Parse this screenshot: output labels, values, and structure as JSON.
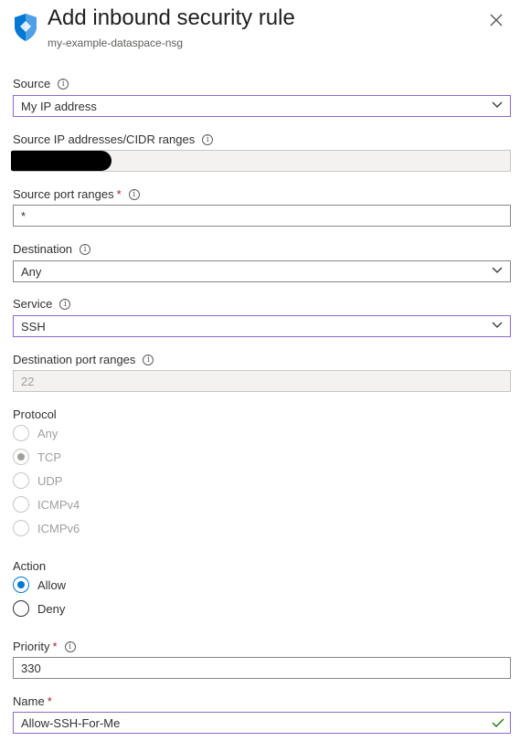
{
  "header": {
    "title": "Add inbound security rule",
    "subtitle": "my-example-dataspace-nsg"
  },
  "colors": {
    "shield": "#0078d4",
    "focus_border": "#8a6cc7",
    "radio_selected": "#0078d4",
    "required": "#a4262c",
    "valid_check": "#107c10"
  },
  "form": {
    "source": {
      "label": "Source",
      "value": "My IP address"
    },
    "source_ip": {
      "label": "Source IP addresses/CIDR ranges",
      "value": ""
    },
    "source_port": {
      "label": "Source port ranges",
      "required": "*",
      "value": "*"
    },
    "destination": {
      "label": "Destination",
      "value": "Any"
    },
    "service": {
      "label": "Service",
      "value": "SSH"
    },
    "dest_port": {
      "label": "Destination port ranges",
      "value": "22"
    },
    "protocol": {
      "label": "Protocol",
      "options": [
        "Any",
        "TCP",
        "UDP",
        "ICMPv4",
        "ICMPv6"
      ],
      "selected": "TCP",
      "disabled": true
    },
    "action": {
      "label": "Action",
      "options": [
        "Allow",
        "Deny"
      ],
      "selected": "Allow"
    },
    "priority": {
      "label": "Priority",
      "required": "*",
      "value": "330"
    },
    "name": {
      "label": "Name",
      "required": "*",
      "value": "Allow-SSH-For-Me"
    }
  },
  "icons": {
    "shield": "shield-icon",
    "close": "close-icon",
    "info": "info-icon",
    "chevron": "chevron-down-icon",
    "check": "check-icon"
  }
}
